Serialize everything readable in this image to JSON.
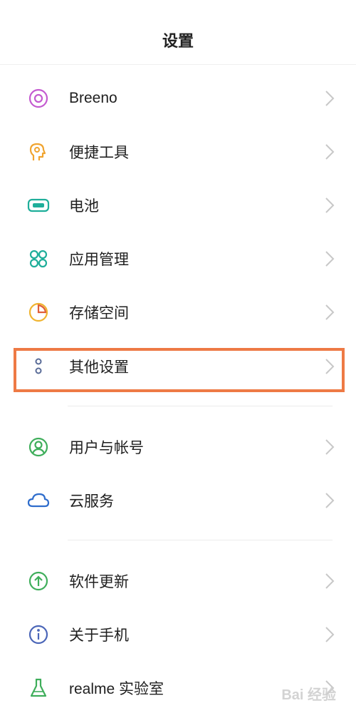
{
  "header": {
    "title": "设置"
  },
  "items": [
    {
      "label": "Breeno",
      "icon": "breeno-icon",
      "color": "#c45bd0"
    },
    {
      "label": "便捷工具",
      "icon": "quick-tools-icon",
      "color": "#f0a430"
    },
    {
      "label": "电池",
      "icon": "battery-icon",
      "color": "#1fae9a"
    },
    {
      "label": "应用管理",
      "icon": "app-management-icon",
      "color": "#1fae9a"
    },
    {
      "label": "存储空间",
      "icon": "storage-icon",
      "color": "#f0b430"
    },
    {
      "label": "其他设置",
      "icon": "other-settings-icon",
      "color": "#5a6c98"
    },
    {
      "label": "用户与帐号",
      "icon": "user-account-icon",
      "color": "#3fae5b"
    },
    {
      "label": "云服务",
      "icon": "cloud-service-icon",
      "color": "#2f6dcc"
    },
    {
      "label": "软件更新",
      "icon": "software-update-icon",
      "color": "#3fae5b"
    },
    {
      "label": "关于手机",
      "icon": "about-phone-icon",
      "color": "#4b66b8"
    },
    {
      "label": "realme 实验室",
      "icon": "realme-lab-icon",
      "color": "#3fae5b"
    }
  ],
  "highlight_color": "#ee7a45",
  "watermark": "Bai 经验"
}
